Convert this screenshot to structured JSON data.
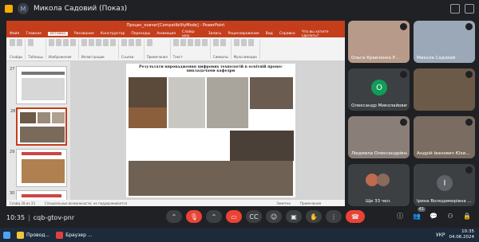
{
  "meet": {
    "account_initial": "M",
    "account_name": "Микола Садовий (Показ)",
    "time": "10:35",
    "meeting_code": "cqb-gtov-pnr"
  },
  "ppt": {
    "doc_title": "Процес_ковчег[CompatibilityMode] - PowerPoint",
    "menu": [
      "Файл",
      "Главная",
      "Вставка",
      "Рисование",
      "Конструктор",
      "Переходы",
      "Анимация",
      "Слайд-шоу",
      "Запись",
      "Рецензирование",
      "Вид",
      "Справка",
      "Что вы хотите сделать?"
    ],
    "ribbon_groups": [
      "Слайды",
      "Таблицы",
      "Изображения",
      "Иллюстрации",
      "Ссылки",
      "Примечания",
      "Текст",
      "Символы",
      "Мультимедиа"
    ],
    "slide_heading": "Результати впровадження цифрових технологій в освітній процес викладачами кафедри",
    "thumb_numbers": [
      "27",
      "28",
      "29",
      "30"
    ],
    "status_left": "Слайд 28 из 33",
    "status_mid": "Специальные возможности: не поддерживается",
    "status_notes": "Заметки",
    "status_comments": "Примечания"
  },
  "tiles": [
    {
      "name": "Ольга Кравченко Р...",
      "kind": "video",
      "color": "#b89a8a"
    },
    {
      "name": "Микола Садовий",
      "kind": "video",
      "color": "#9aa8b8"
    },
    {
      "name": "Олександр Миколайович...",
      "kind": "avatar",
      "initial": "О",
      "color": "#0f9d58"
    },
    {
      "name": "",
      "kind": "video",
      "color": "#6c5a48"
    },
    {
      "name": "Людмила Олександрівна...",
      "kind": "video",
      "color": "#8a7f78"
    },
    {
      "name": "Андрій Іванович Юхи...",
      "kind": "video",
      "color": "#7a6c60"
    },
    {
      "name": "Ще 33 чел.",
      "kind": "more",
      "color": "#c06a50"
    },
    {
      "name": "Ірина Володимирівна ...",
      "kind": "avatar",
      "initial": "І",
      "color": "#5f6368"
    }
  ],
  "controls": {
    "participants_count": "41",
    "end_call_icon": "phone-hangup-icon"
  },
  "taskbar": {
    "apps": [
      "Провод...",
      "Браузер ..."
    ],
    "clock_time": "10:35",
    "clock_date": "04.06.2024",
    "lang": "УКР"
  }
}
